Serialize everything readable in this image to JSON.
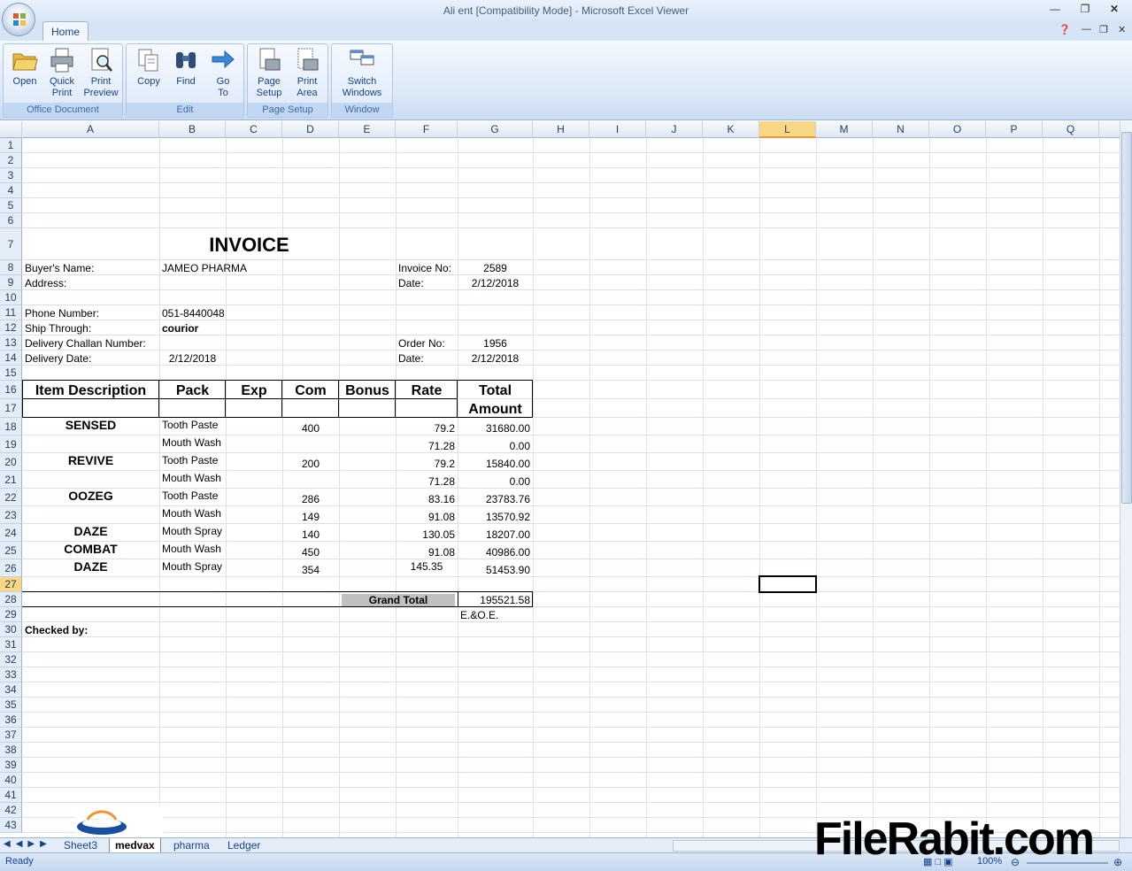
{
  "window": {
    "title": "Ali ent  [Compatibility Mode] - Microsoft Excel Viewer",
    "minimize_icon": "minimize-icon",
    "restore_icon": "restore-icon",
    "close_icon": "close-icon"
  },
  "ribbon": {
    "tab": "Home",
    "groups": [
      {
        "label": "Office Document",
        "buttons": [
          "Open",
          "Quick Print",
          "Print Preview"
        ]
      },
      {
        "label": "Edit",
        "buttons": [
          "Copy",
          "Find",
          "Go To"
        ]
      },
      {
        "label": "Page Setup",
        "buttons": [
          "Page Setup",
          "Print Area"
        ]
      },
      {
        "label": "Window",
        "buttons": [
          "Switch Windows"
        ]
      }
    ]
  },
  "columns": [
    "A",
    "B",
    "C",
    "D",
    "E",
    "F",
    "G",
    "H",
    "I",
    "J",
    "K",
    "L",
    "M",
    "N",
    "O",
    "P",
    "Q"
  ],
  "selected_column": "L",
  "selected_row": "27",
  "rows": [
    "1",
    "2",
    "3",
    "4",
    "5",
    "6",
    "7",
    "8",
    "9",
    "10",
    "11",
    "12",
    "13",
    "14",
    "15",
    "16",
    "17",
    "18",
    "19",
    "20",
    "21",
    "22",
    "23",
    "24",
    "25",
    "26",
    "27",
    "28",
    "29",
    "30",
    "31",
    "32",
    "33",
    "34",
    "35",
    "36",
    "37",
    "38",
    "39",
    "40",
    "41",
    "42",
    "43"
  ],
  "invoice": {
    "title": "INVOICE",
    "buyer_label": "Buyer's Name:",
    "buyer_value": "JAMEO PHARMA",
    "address_label": "Address:",
    "phone_label": "Phone Number:",
    "phone_value": "051-8440048",
    "ship_label": "Ship Through:",
    "ship_value": "courior",
    "challan_label": "Delivery Challan Number:",
    "delivery_label": "Delivery Date:",
    "delivery_value": "2/12/2018",
    "invoice_no_label": "Invoice No:",
    "invoice_no_value": "2589",
    "date_label": "Date:",
    "date_value": "2/12/2018",
    "order_no_label": "Order No:",
    "order_no_value": "1956",
    "date2_label": "Date:",
    "date2_value": "2/12/2018"
  },
  "table": {
    "headers": [
      "Item Description",
      "Pack",
      "Exp",
      "Com",
      "Bonus",
      "Rate",
      "Total"
    ],
    "header2": "Amount",
    "rows": [
      {
        "item": "SENSED",
        "pack": "Tooth Paste",
        "com": "400",
        "rate": "79.2",
        "total": "31680.00"
      },
      {
        "item": "",
        "pack": "Mouth Wash",
        "com": "",
        "rate": "71.28",
        "total": "0.00"
      },
      {
        "item": "REVIVE",
        "pack": "Tooth Paste",
        "com": "200",
        "rate": "79.2",
        "total": "15840.00"
      },
      {
        "item": "",
        "pack": "Mouth Wash",
        "com": "",
        "rate": "71.28",
        "total": "0.00"
      },
      {
        "item": "OOZEG",
        "pack": "Tooth Paste",
        "com": "286",
        "rate": "83.16",
        "total": "23783.76"
      },
      {
        "item": "",
        "pack": "Mouth Wash",
        "com": "149",
        "rate": "91.08",
        "total": "13570.92"
      },
      {
        "item": "DAZE",
        "pack": "Mouth Spray",
        "com": "140",
        "rate": "130.05",
        "total": "18207.00"
      },
      {
        "item": "COMBAT",
        "pack": "Mouth Wash",
        "com": "450",
        "rate": "91.08",
        "total": "40986.00"
      },
      {
        "item": "DAZE",
        "pack": "Mouth Spray",
        "com": "354",
        "rate": "145.35",
        "total": "51453.90"
      }
    ],
    "grand_total_label": "Grand Total",
    "grand_total_value": "195521.58",
    "eoe": "E.&O.E.",
    "checked_by": "Checked by:"
  },
  "sheets": [
    "Sheet3",
    "medvax",
    "pharma",
    "Ledger"
  ],
  "active_sheet": "medvax",
  "status": {
    "text": "Ready",
    "zoom": "100%"
  },
  "watermark": "FileRabit.com"
}
